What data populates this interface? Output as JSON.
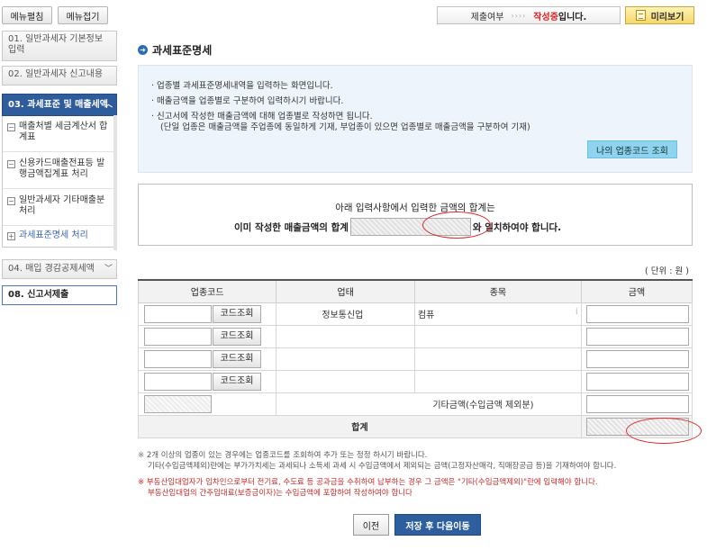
{
  "sidebar": {
    "expand_all": "메뉴펼침",
    "collapse_all": "메뉴접기",
    "items": [
      {
        "label": "01. 일반과세자 기본정보 입력"
      },
      {
        "label": "02. 일반과세자 신고내용"
      },
      {
        "label": "03. 과세표준 및 매출세액"
      },
      {
        "label": "04. 매입 경감공제세액"
      },
      {
        "label": "08. 신고서제출"
      }
    ],
    "sub_items": [
      {
        "label": "매출처별 세금계산서 합계표"
      },
      {
        "label": "신용카드매출전표등 발행금액집계표 처리"
      },
      {
        "label": "일반과세자 기타매출분 처리"
      },
      {
        "label": "과세표준명세 처리"
      }
    ]
  },
  "status": {
    "label": "제출여부",
    "arrows": "››››",
    "state": "작성중",
    "state_suffix": "입니다.",
    "preview_label": "미리보기"
  },
  "section_title": "과세표준명세",
  "info": {
    "lines": [
      "· 업종별 과세표준명세내역을 입력하는 화면입니다.",
      "· 매출금액을 업종별로 구분하여 입력하시기 바랍니다.",
      "· 신고서에 작성한 매출금액에 대해 업종별로 작성하면 됩니다."
    ],
    "subline": "(단일 업종은 매출금액을 주업종에 동일하게 기재, 부업종이 있으면 업종별로 매출금액을 구분하여 기재)",
    "code_button": "나의 업종코드 조회"
  },
  "sumcheck": {
    "line1": "아래 입력사항에서  입력한 금액의 합계는",
    "line2_prefix": "이미 작성한 매출금액의 합계",
    "line2_suffix": "와 일치하여야 합니다."
  },
  "unit": "( 단위 : 원 )",
  "table": {
    "headers": [
      "업종코드",
      "업태",
      "종목",
      "금액"
    ],
    "code_button": "코드조회",
    "rows": [
      {
        "business_type": "정보통신업",
        "item": "컴퓨"
      },
      {
        "business_type": "",
        "item": ""
      },
      {
        "business_type": "",
        "item": ""
      },
      {
        "business_type": "",
        "item": ""
      },
      {
        "business_type": "기타금액(수입금액 제외분)",
        "item": ""
      }
    ],
    "total_label": "합계"
  },
  "notes": [
    {
      "mark": "※",
      "text": "2개 이상의 업종이 있는 경우에는 업종코드를 조회하여 추가 또는 정정 하시기 바랍니다.",
      "text2": "기타(수입금액제외)란에는 부가가치세는 과세되나 소득세 과세 시 수입금액에서 제외되는 금액(고정자산매각, 직매장공급 등)을 기재하여야 합니다."
    },
    {
      "mark": "※",
      "text": "부동산임대업자가 임차인으로부터 전기료, 수도료 등 공과금을 수취하여 납부하는 경우 그 금액은 \"기타(수입금액제외)\"란에 입력해야 합니다.",
      "text2": "부동산임대업의 간주임대료(보증금이자)는 수입금액에 포함하여 작성하여야 합니다"
    }
  ],
  "buttons": {
    "prev": "이전",
    "save_next": "저장 후 다음이동"
  },
  "colors": {
    "accent": "#2f5d9b",
    "warning_red": "#e0262d",
    "info_bg": "#eef4fb",
    "code_button_bg": "#8fd3ee"
  }
}
